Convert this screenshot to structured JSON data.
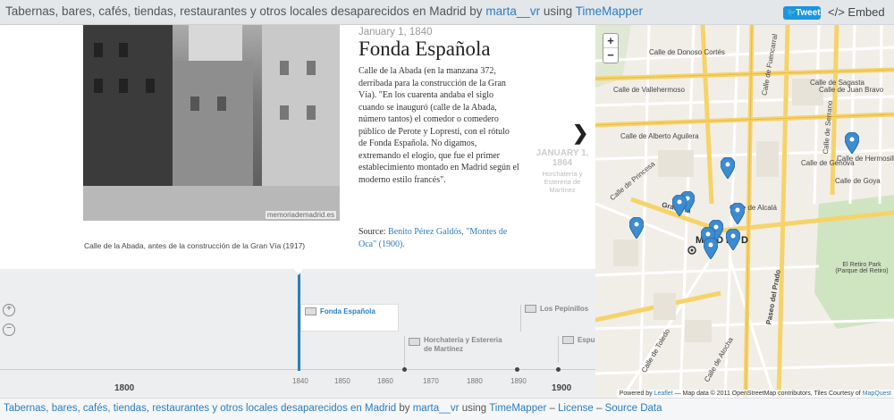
{
  "header": {
    "title_text": "Tabernas, bares, cafés, tiendas, restaurantes y otros locales desaparecidos en Madrid",
    "by_label": "by",
    "author": "marta__vr",
    "using_label": "using",
    "app_name": "TimeMapper",
    "tweet_label": "Tweet",
    "embed_label": "</> Embed"
  },
  "slide": {
    "date": "January 1, 1840",
    "headline": "Fonda Española",
    "body": "Calle de la Abada (en la manzana 372, derribada para la construcción de la Gran Vía). \"En los cuarenta andaba el siglo cuando se inauguró (calle de la Abada, número tantos) el comedor o comedero público de Perote y Lopresti, con el rótulo de Fonda Española. No digamos, extremando el elogio, que fue el primer establecimiento montado en Madrid según el moderno estilo francés\".",
    "source_label": "Source:",
    "source_link": "Benito Pérez Galdós, \"Montes de Oca\" (1900).",
    "photo_credit": "memoriademadrid.es",
    "caption": "Calle de la Abada, antes de la construcción de la Gran Vía (1917)"
  },
  "next_slide": {
    "date": "JANUARY 1, 1864",
    "title": "Horchatería y Estereria de Martínez"
  },
  "timeline": {
    "events": [
      {
        "label": "Fonda Española",
        "active": true
      },
      {
        "label": "Los Pepinillos",
        "active": false
      },
      {
        "label": "Horchatería y Estereria de Martínez",
        "active": false
      },
      {
        "label": "Espu",
        "active": false
      }
    ],
    "ticks_minor": [
      "1840",
      "1850",
      "1860",
      "1870",
      "1880",
      "1890"
    ],
    "ticks_major": [
      "1800",
      "1900"
    ]
  },
  "map": {
    "city_label": "MADRID",
    "streets": [
      "Calle de Donoso Cortés",
      "Calle de Vallehermoso",
      "Calle de Alberto Aguilera",
      "Calle de Fuencarral",
      "Calle de Sagasta",
      "Calle de Génova",
      "Calle de Hermosilla",
      "Gran Vía",
      "Paseo del Prado",
      "Calle de Alcalá",
      "Calle de Toledo",
      "Calle de Atocha",
      "Calle de Serrano",
      "Calle de Juan Bravo",
      "Calle de Goya",
      "Calle de Princesa"
    ],
    "park_label": "El Retiro Park (Parque del Retiro)",
    "attribution_prefix": "Powered by",
    "attribution_leaflet": "Leaflet",
    "attribution_data": "— Map data © 2011 OpenStreetMap contributors, Tiles Courtesy of",
    "attribution_mapquest": "MapQuest",
    "pin_color": "#3d8bd1"
  },
  "footer": {
    "title_text": "Tabernas, bares, cafés, tiendas, restaurantes y otros locales desaparecidos en Madrid",
    "by_label": "by",
    "author": "marta__vr",
    "using_label": "using",
    "app_name": "TimeMapper",
    "license": "License",
    "source_data": "Source Data",
    "sep": "–"
  }
}
